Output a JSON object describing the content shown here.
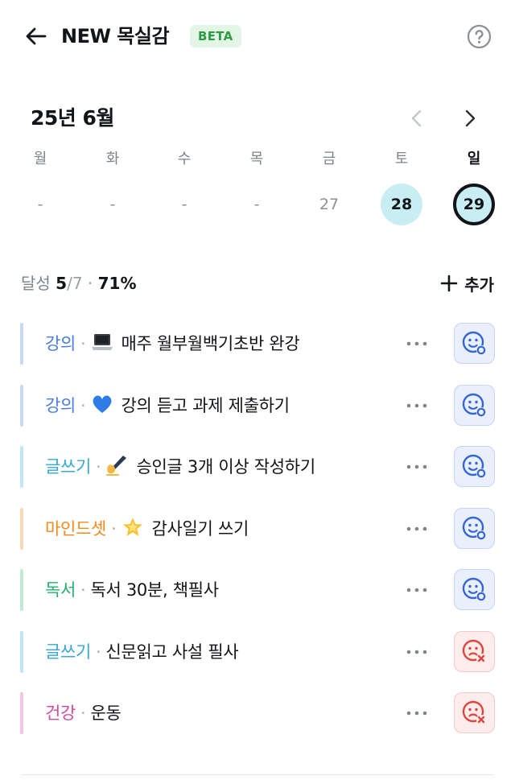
{
  "header": {
    "title": "NEW 목실감",
    "badge": "BETA"
  },
  "calendar": {
    "month_label": "25년 6월",
    "days": [
      {
        "label": "월",
        "date": "-",
        "state": "empty"
      },
      {
        "label": "화",
        "date": "-",
        "state": "empty"
      },
      {
        "label": "수",
        "date": "-",
        "state": "empty"
      },
      {
        "label": "목",
        "date": "-",
        "state": "empty"
      },
      {
        "label": "금",
        "date": "27",
        "state": "plain"
      },
      {
        "label": "토",
        "date": "28",
        "state": "done"
      },
      {
        "label": "일",
        "date": "29",
        "state": "today"
      }
    ]
  },
  "summary": {
    "prefix": "달성",
    "done": "5",
    "total": "/7",
    "dot": "·",
    "percent": "71%",
    "add_label": "추가"
  },
  "items": [
    {
      "category": "강의",
      "emoji": "laptop-emoji",
      "text": "매주 월부월백기초반 완강",
      "color": "#4a7be0",
      "bar": "#c9d6f7",
      "status": "done"
    },
    {
      "category": "강의",
      "emoji": "blue-heart-emoji",
      "text": "강의 듣고 과제 제출하기",
      "color": "#4a7be0",
      "bar": "#c9d6f7",
      "status": "done"
    },
    {
      "category": "글쓰기",
      "emoji": "writing-hand-emoji",
      "text": "승인글 3개 이상 작성하기",
      "color": "#35a8d8",
      "bar": "#bfe6f5",
      "status": "done"
    },
    {
      "category": "마인드셋",
      "emoji": "glowing-star-emoji",
      "text": "감사일기 쓰기",
      "color": "#f08a1c",
      "bar": "#fbd9b3",
      "status": "done"
    },
    {
      "category": "독서",
      "emoji": "",
      "text": "독서 30분, 책필사",
      "color": "#23b06e",
      "bar": "#bdebd4",
      "status": "done"
    },
    {
      "category": "글쓰기",
      "emoji": "",
      "text": "신문읽고 사설 필사",
      "color": "#35a8d8",
      "bar": "#bfe6f5",
      "status": "missed"
    },
    {
      "category": "건강",
      "emoji": "",
      "text": "운동",
      "color": "#d34a9b",
      "bar": "#f6c3e0",
      "status": "missed"
    }
  ],
  "colors": {
    "done_icon": "#3566d6",
    "missed_icon": "#e0453d",
    "today_ring": "#111418",
    "done_fill": "#c8eef3",
    "beta_bg": "#e3f6e6",
    "beta_fg": "#2d9b45"
  }
}
